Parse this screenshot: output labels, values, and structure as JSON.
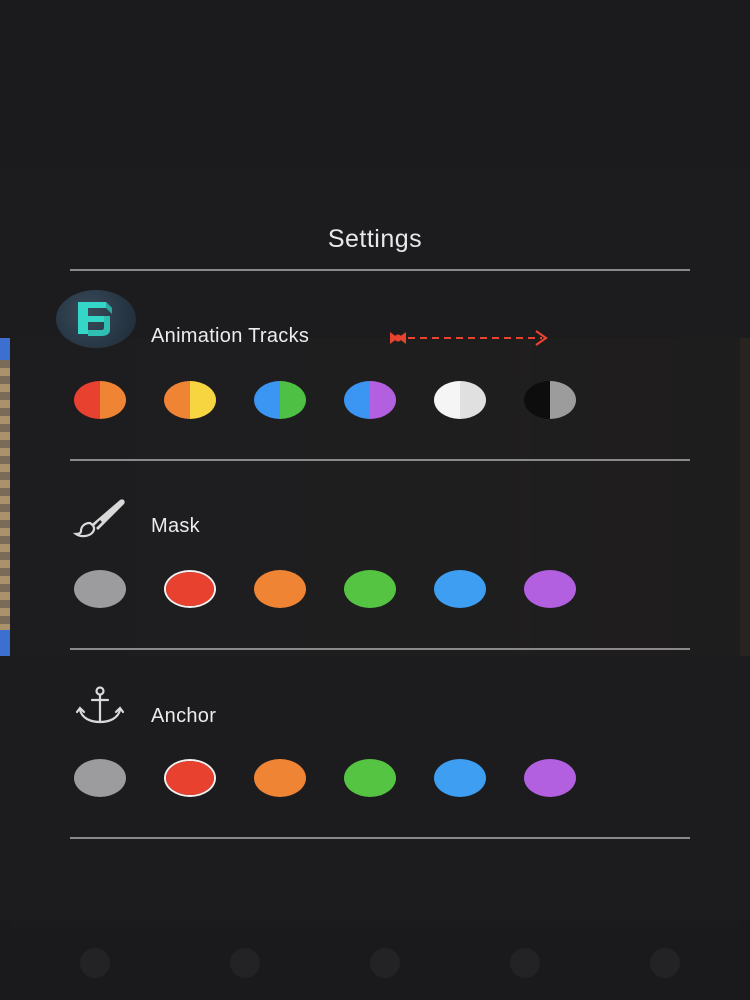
{
  "panel": {
    "title": "Settings"
  },
  "sections": [
    {
      "id": "animation-tracks",
      "label": "Animation Tracks",
      "icon": "logo-icon",
      "swatches": [
        {
          "left": "#e8412f",
          "right": "#ef8434"
        },
        {
          "left": "#ef8434",
          "right": "#f7d540"
        },
        {
          "left": "#3b95f2",
          "right": "#4ec043"
        },
        {
          "left": "#3b95f2",
          "right": "#b25fe0"
        },
        {
          "left": "#f5f5f5",
          "right": "#e0e0e0"
        },
        {
          "left": "#0d0d0d",
          "right": "#9c9c9c"
        }
      ]
    },
    {
      "id": "mask",
      "label": "Mask",
      "icon": "brush-icon",
      "swatches": [
        {
          "left": "#9c9c9e",
          "right": "#9c9c9e"
        },
        {
          "left": "#e8412f",
          "right": "#e8412f",
          "selected": true
        },
        {
          "left": "#ef8434",
          "right": "#ef8434"
        },
        {
          "left": "#55c443",
          "right": "#55c443"
        },
        {
          "left": "#3d9ef2",
          "right": "#3d9ef2"
        },
        {
          "left": "#b25fe0",
          "right": "#b25fe0"
        }
      ]
    },
    {
      "id": "anchor",
      "label": "Anchor",
      "icon": "anchor-icon",
      "swatches": [
        {
          "left": "#9c9c9e",
          "right": "#9c9c9e"
        },
        {
          "left": "#e8412f",
          "right": "#e8412f",
          "selected": true
        },
        {
          "left": "#ef8434",
          "right": "#ef8434"
        },
        {
          "left": "#55c443",
          "right": "#55c443"
        },
        {
          "left": "#3d9ef2",
          "right": "#3d9ef2"
        },
        {
          "left": "#b25fe0",
          "right": "#b25fe0"
        }
      ]
    }
  ],
  "colors": {
    "accent_arrow": "#e8432f",
    "divider": "#8a8a8c"
  }
}
